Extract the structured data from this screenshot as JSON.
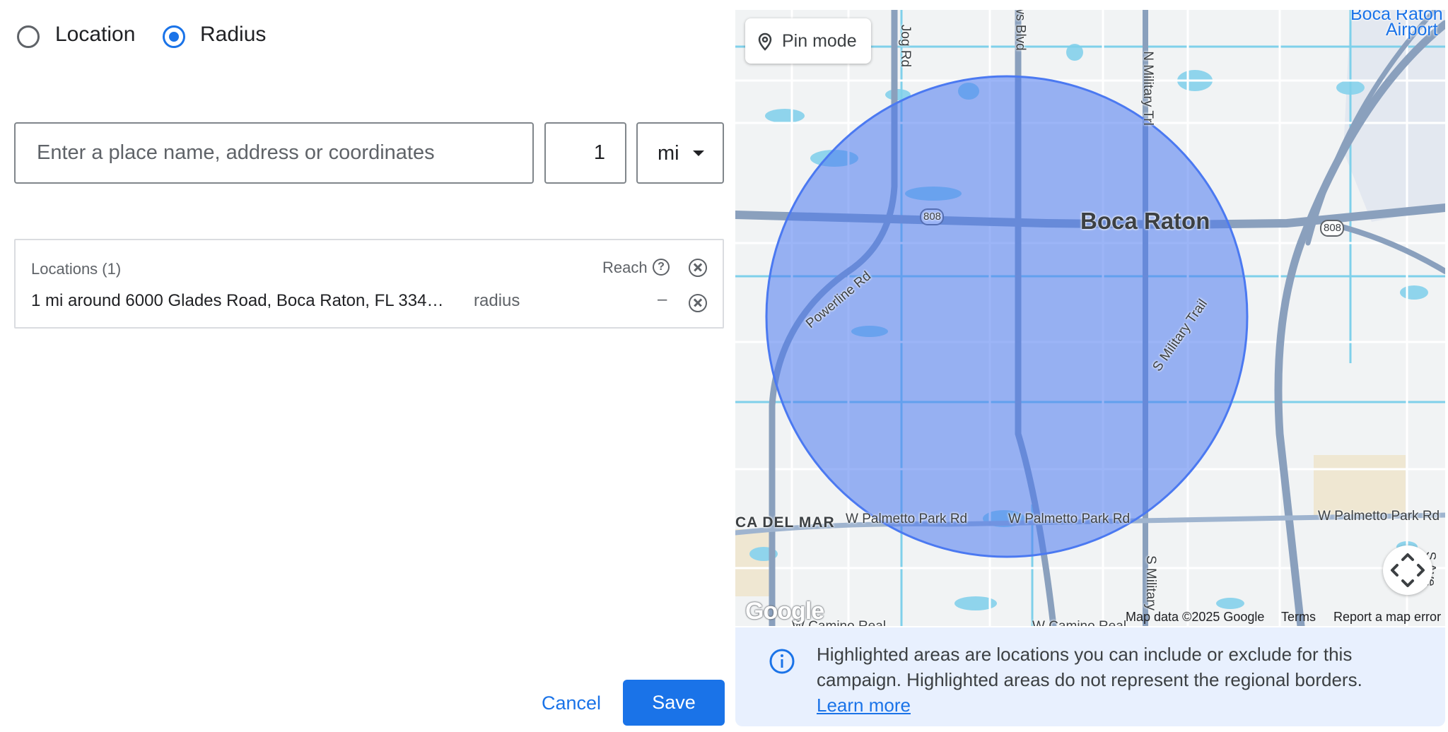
{
  "mode": {
    "location_label": "Location",
    "radius_label": "Radius",
    "selected": "Radius"
  },
  "search": {
    "placeholder": "Enter a place name, address or coordinates",
    "value": ""
  },
  "radius": {
    "value": "1",
    "unit": "mi"
  },
  "locations": {
    "header": "Locations (1)",
    "reach_label": "Reach",
    "items": [
      {
        "text": "1 mi around 6000 Glades Road, Boca Raton, FL 334…",
        "type": "radius",
        "reach": "–"
      }
    ]
  },
  "footer": {
    "cancel_label": "Cancel",
    "save_label": "Save"
  },
  "map": {
    "pin_mode_label": "Pin mode",
    "labels": {
      "city": "Boca Raton",
      "airport_1": "Boca Raton",
      "airport_2": "Airport",
      "jog_rd": "Jog Rd",
      "ws_blvd": "ws Blvd",
      "n_military": "N Military Trl",
      "powerline": "Powerline Rd",
      "s_military_trail": "S Military Trail",
      "shield_808": "808",
      "ca_del_mar": "CA DEL MAR",
      "w_palmetto_1": "W Palmetto Park Rd",
      "w_palmetto_2": "W Palmetto Park Rd",
      "w_palmetto_3": "W Palmetto Park Rd",
      "s_military_bottom": "S Military",
      "w_camino": "W Camino Real",
      "w_camino_2": "W Camino Real",
      "s_ave": "S Ave"
    },
    "google_logo": "Google",
    "attribution": "Map data ©2025 Google",
    "terms": "Terms",
    "report": "Report a map error",
    "radius_color": "#4b79f1"
  },
  "info": {
    "text": "Highlighted areas are locations you can include or exclude for this campaign. Highlighted areas do not represent the regional borders.",
    "link": "Learn more"
  },
  "colors": {
    "accent": "#1a73e8",
    "info_bg": "#e8f0fe"
  }
}
